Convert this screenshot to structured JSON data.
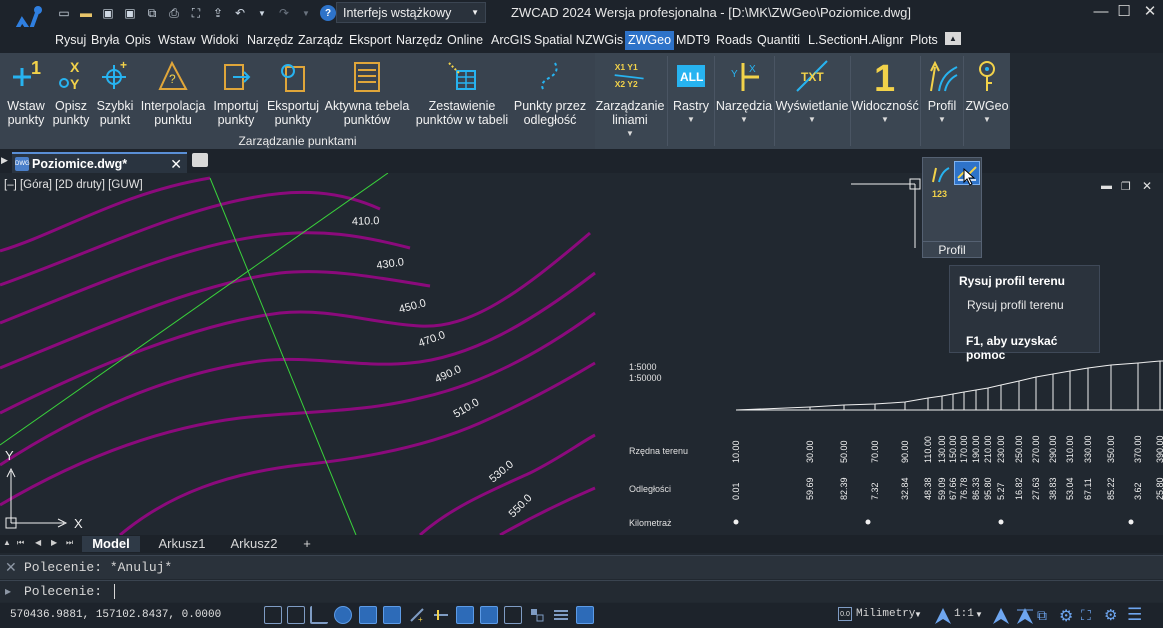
{
  "titlebar": {
    "workspace": "Interfejs wstążkowy",
    "window_title": "ZWCAD 2024 Wersja profesjonalna - [D:\\MK\\ZWGeo\\Poziomice.dwg]",
    "minimize": "—",
    "maximize": "☐",
    "close": "✕"
  },
  "menu": {
    "tabs": [
      "Rysuj",
      "Bryła",
      "Opis",
      "Wstaw",
      "Widoki",
      "Narzędz",
      "Zarządz",
      "Eksport",
      "Narzędz",
      "Online",
      "ArcGIS",
      "Spatial N",
      "ZWGis",
      "ZWGeo",
      "MDT9",
      "Roads",
      "Quantiti",
      "L.Section",
      "H.Alignr",
      "Plots"
    ],
    "active": "ZWGeo"
  },
  "ribbon": {
    "buttons": [
      {
        "label": "Wstaw\npunkty",
        "icon": "insert-points-icon"
      },
      {
        "label": "Opisz\npunkty",
        "icon": "describe-points-icon"
      },
      {
        "label": "Szybki\npunkt",
        "icon": "quick-point-icon"
      },
      {
        "label": "Interpolacja\npunktu",
        "icon": "interpolation-icon"
      },
      {
        "label": "Importuj\npunkty",
        "icon": "import-points-icon"
      },
      {
        "label": "Eksportuj\npunkty",
        "icon": "export-points-icon"
      },
      {
        "label": "Aktywna tebela\npunktów",
        "icon": "active-table-icon"
      },
      {
        "label": "Zestawienie\npunktów w tabeli",
        "icon": "points-table-icon"
      },
      {
        "label": "Punkty przez\nodległość",
        "icon": "points-distance-icon"
      }
    ],
    "dropdowns": [
      {
        "label": "Zarządzanie\nliniami",
        "icon": "lines-management-icon"
      },
      {
        "label": "Rastry",
        "icon": "rasters-icon"
      },
      {
        "label": "Narzędzia",
        "icon": "tools-icon"
      },
      {
        "label": "Wyświetlanie",
        "icon": "display-icon"
      },
      {
        "label": "Widoczność",
        "icon": "visibility-icon"
      },
      {
        "label": "Profil",
        "icon": "profile-icon"
      },
      {
        "label": "ZWGeo",
        "icon": "zwgeo-icon"
      }
    ],
    "panel_label": "Zarządzanie punktami",
    "lines_icon_text": "X1 Y1\nX2 Y2",
    "rasters_icon_text": "ALL",
    "display_icon_text": "TXT",
    "visibility_icon_text": "1"
  },
  "document": {
    "tab_label": "Poziomice.dwg*",
    "viewport_label": "[–] [Góra] [2D druty] [GUW]"
  },
  "contours": {
    "labels": [
      "410.0",
      "430.0",
      "450.0",
      "470.0",
      "490.0",
      "510.0",
      "530.0",
      "550.0"
    ]
  },
  "axis": {
    "x": "X",
    "y": "Y"
  },
  "profile": {
    "scales": [
      "1:5000",
      "1:50000"
    ],
    "row_labels": [
      "Rzędna terenu",
      "Odległości",
      "Kilometraż"
    ],
    "elevations": [
      "10.00",
      "30.00",
      "50.00",
      "70.00",
      "90.00",
      "110.00",
      "130.00",
      "150.00",
      "170.00",
      "190.00",
      "210.00",
      "230.00",
      "250.00",
      "270.00",
      "290.00",
      "310.00",
      "330.00",
      "350.00",
      "370.00",
      "390.00"
    ],
    "distances": [
      "0.01",
      "59.69",
      "82.39",
      "7.32",
      "32.84",
      "48.38",
      "59.09",
      "67.66",
      "76.78",
      "86.33",
      "95.80",
      "5.27",
      "16.82",
      "27.63",
      "38.83",
      "53.04",
      "67.11",
      "85.22",
      "3.62",
      "25.80"
    ]
  },
  "profil_panel": {
    "label": "Profil"
  },
  "tooltip": {
    "title": "Rysuj profil terenu",
    "description": "Rysuj profil terenu",
    "help": "F1, aby uzyskać pomoc"
  },
  "layouts": {
    "tabs": [
      "Model",
      "Arkusz1",
      "Arkusz2"
    ],
    "active": "Model",
    "add": "+"
  },
  "command": {
    "history": "Polecenie: *Anuluj*",
    "prompt": "Polecenie:"
  },
  "status": {
    "coords": "570436.9881, 157102.8437, 0.0000",
    "units": "Milimetry",
    "scale": "1:1"
  },
  "colors": {
    "contour": "#8b0a7c",
    "gridline": "#39d23b",
    "accent": "#2e73c9"
  }
}
